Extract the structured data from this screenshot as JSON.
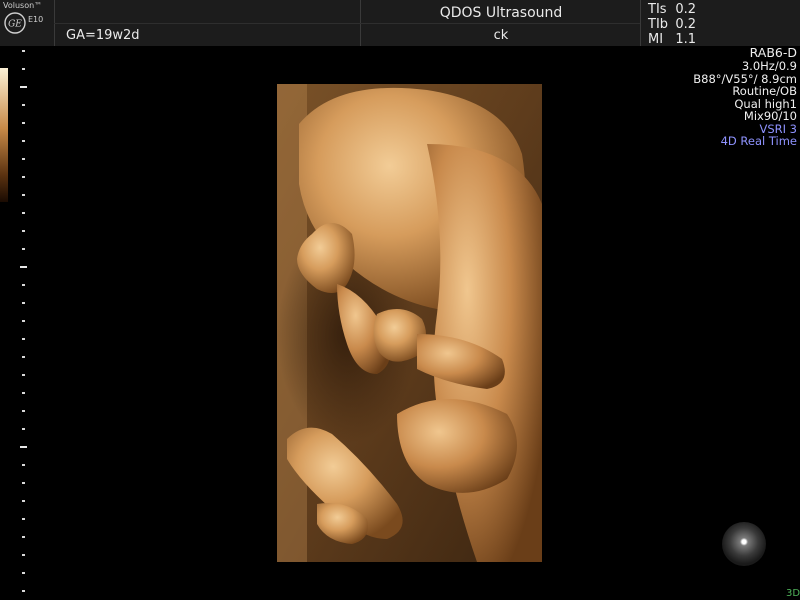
{
  "header": {
    "brand": "Voluson™",
    "model": "E10",
    "logo_text": "GE",
    "ga": "GA=19w2d",
    "site_name": "QDOS Ultrasound",
    "operator": "ck",
    "safety": [
      {
        "label": "TIs",
        "value": "0.2"
      },
      {
        "label": "TIb",
        "value": "0.2"
      },
      {
        "label": "MI",
        "value": "1.1"
      }
    ]
  },
  "params": {
    "probe": "RAB6-D",
    "freq": "3.0Hz/0.9",
    "angles": "B88°/V55°/ 8.9cm",
    "preset": "Routine/OB",
    "quality": "Qual high1",
    "mix": "Mix90/10",
    "vsri": "VSRI 3",
    "mode": "4D Real Time"
  },
  "footer": {
    "mode_tag": "3D"
  },
  "colors": {
    "background": "#000000",
    "header": "#1c1c1c",
    "accent_blue": "#8f93ff",
    "mode_green": "#4fb35a",
    "tissue": "#c88a48"
  },
  "icons": {
    "logo": "ge-logo-icon",
    "orientation": "orientation-sphere-icon"
  }
}
